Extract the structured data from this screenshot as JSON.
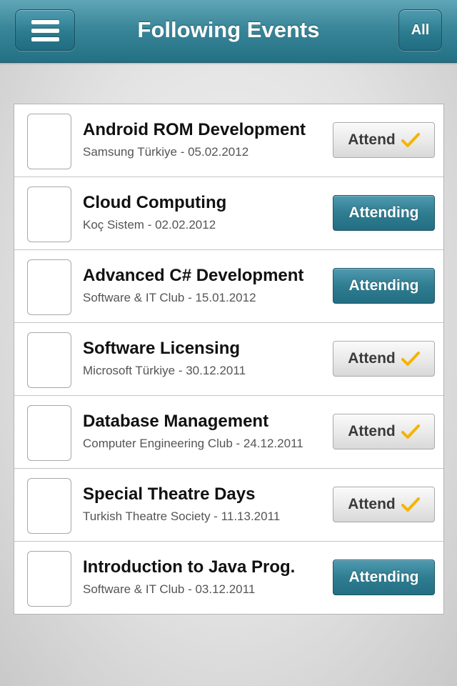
{
  "header": {
    "title": "Following Events",
    "all_label": "All"
  },
  "colors": {
    "nav": "#2f7d91",
    "attending_button": "#2f7d91",
    "check": "#f5b400"
  },
  "events": [
    {
      "title": "Android ROM Development",
      "subtitle": "Samsung Türkiye - 05.02.2012",
      "button": "Attend",
      "state": "attend"
    },
    {
      "title": "Cloud Computing",
      "subtitle": "Koç Sistem - 02.02.2012",
      "button": "Attending",
      "state": "attending"
    },
    {
      "title": "Advanced C# Development",
      "subtitle": "Software & IT Club - 15.01.2012",
      "button": "Attending",
      "state": "attending"
    },
    {
      "title": "Software Licensing",
      "subtitle": "Microsoft Türkiye - 30.12.2011",
      "button": "Attend",
      "state": "attend"
    },
    {
      "title": "Database Management",
      "subtitle": "Computer Engineering Club - 24.12.2011",
      "button": "Attend",
      "state": "attend"
    },
    {
      "title": "Special Theatre Days",
      "subtitle": "Turkish Theatre Society - 11.13.2011",
      "button": "Attend",
      "state": "attend"
    },
    {
      "title": "Introduction to Java Prog.",
      "subtitle": "Software & IT Club - 03.12.2011",
      "button": "Attending",
      "state": "attending"
    }
  ]
}
